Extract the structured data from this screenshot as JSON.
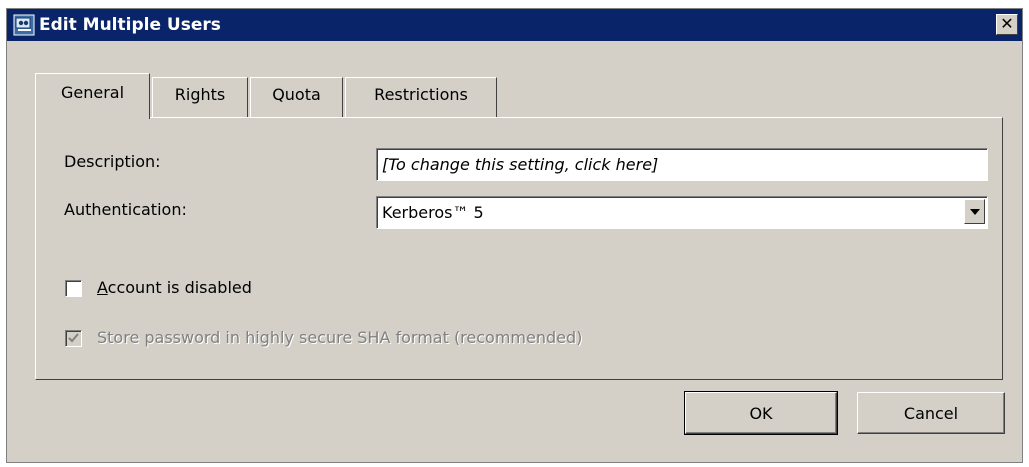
{
  "window": {
    "title": "Edit Multiple Users",
    "close_glyph": "✕",
    "icon": "users-app-icon"
  },
  "tabs": [
    {
      "label": "General",
      "active": true
    },
    {
      "label": "Rights",
      "active": false
    },
    {
      "label": "Quota",
      "active": false
    },
    {
      "label": "Restrictions",
      "active": false
    }
  ],
  "general": {
    "description_label": "Description:",
    "description_value": "[To change this setting, click here]",
    "authentication_label": "Authentication:",
    "authentication_value": "Kerberos™ 5",
    "account_disabled_label": "Account is disabled",
    "account_disabled_checked": false,
    "store_sha_label": "Store password in highly secure SHA format (recommended)",
    "store_sha_checked": true,
    "store_sha_enabled": false
  },
  "buttons": {
    "ok_label": "OK",
    "cancel_label": "Cancel"
  },
  "colors": {
    "titlebar": "#0a246a",
    "face": "#d4d0c8"
  }
}
